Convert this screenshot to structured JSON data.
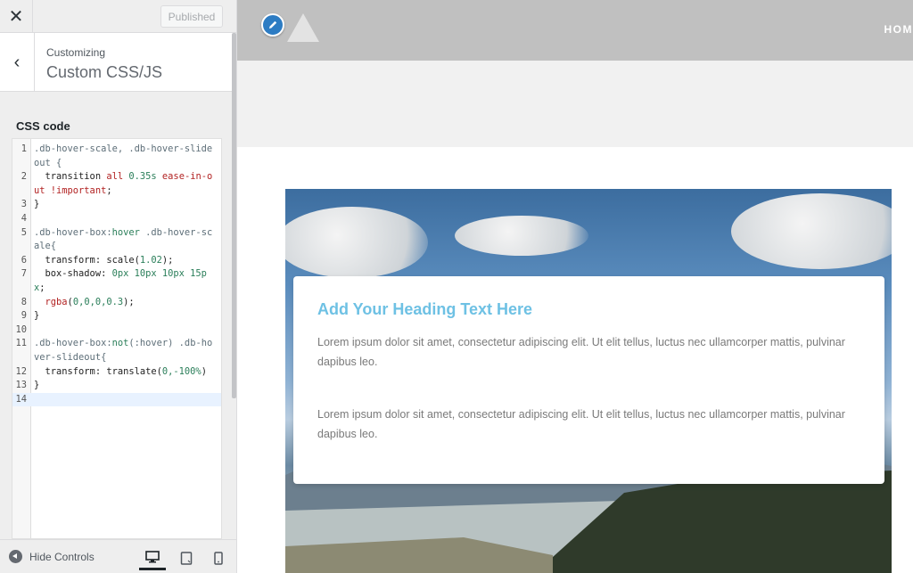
{
  "sidebar": {
    "close_glyph": "✕",
    "published_label": "Published",
    "back_glyph": "‹",
    "breadcrumb": "Customizing",
    "section_title": "Custom CSS/JS",
    "css_label": "CSS code",
    "footer": {
      "hide_controls_label": "Hide Controls",
      "devices": [
        "desktop-icon",
        "tablet-icon",
        "mobile-icon"
      ],
      "active_device": "desktop"
    }
  },
  "editor": {
    "lines": [
      {
        "n": "1",
        "segments": [
          {
            "t": ".db-hover-scale, .db-hover-slideout {",
            "c": "sel"
          }
        ]
      },
      {
        "n": "2",
        "segments": [
          {
            "t": "  transition ",
            "c": "prop"
          },
          {
            "t": "all",
            "c": "str"
          },
          {
            "t": " 0.35s ",
            "c": "num"
          },
          {
            "t": "ease-in-out",
            "c": "str"
          },
          {
            "t": " !important",
            "c": "str"
          },
          {
            "t": ";",
            "c": "prop"
          }
        ]
      },
      {
        "n": "3",
        "segments": [
          {
            "t": "}",
            "c": "prop"
          }
        ]
      },
      {
        "n": "4",
        "segments": [
          {
            "t": "",
            "c": "prop"
          }
        ]
      },
      {
        "n": "5",
        "segments": [
          {
            "t": ".db-hover-box:",
            "c": "sel"
          },
          {
            "t": "hover",
            "c": "num"
          },
          {
            "t": " .db-hover-scale{",
            "c": "sel"
          }
        ]
      },
      {
        "n": "6",
        "segments": [
          {
            "t": "  transform: scale(",
            "c": "prop"
          },
          {
            "t": "1.02",
            "c": "num"
          },
          {
            "t": ");",
            "c": "prop"
          }
        ]
      },
      {
        "n": "7",
        "segments": [
          {
            "t": "  box-shadow: ",
            "c": "prop"
          },
          {
            "t": "0px 10px 10px 15px",
            "c": "num"
          },
          {
            "t": ";",
            "c": "prop"
          }
        ]
      },
      {
        "n": "8",
        "segments": [
          {
            "t": "  rgba",
            "c": "str"
          },
          {
            "t": "(",
            "c": "prop"
          },
          {
            "t": "0,0,0,0.3",
            "c": "num"
          },
          {
            "t": ");",
            "c": "prop"
          }
        ]
      },
      {
        "n": "9",
        "segments": [
          {
            "t": "}",
            "c": "prop"
          }
        ]
      },
      {
        "n": "10",
        "segments": [
          {
            "t": "",
            "c": "prop"
          }
        ]
      },
      {
        "n": "11",
        "segments": [
          {
            "t": ".db-hover-box:",
            "c": "sel"
          },
          {
            "t": "not",
            "c": "num"
          },
          {
            "t": "(:hover) .db-hover-slideout{",
            "c": "sel"
          }
        ]
      },
      {
        "n": "12",
        "segments": [
          {
            "t": "  transform: translate(",
            "c": "prop"
          },
          {
            "t": "0,-100%",
            "c": "num"
          },
          {
            "t": ")",
            "c": "prop"
          }
        ]
      },
      {
        "n": "13",
        "segments": [
          {
            "t": "}",
            "c": "prop"
          }
        ]
      },
      {
        "n": "14",
        "segments": [
          {
            "t": "",
            "c": "prop"
          }
        ],
        "active": true
      }
    ]
  },
  "preview": {
    "edit_icon": "pencil-icon",
    "nav_home": "HOM",
    "card": {
      "heading": "Add Your Heading Text Here",
      "paragraph_1": "Lorem ipsum dolor sit amet, consectetur adipiscing elit. Ut elit tellus, luctus nec ullamcorper mattis, pulvinar dapibus leo.",
      "paragraph_2": "Lorem ipsum dolor sit amet, consectetur adipiscing elit. Ut elit tellus, luctus nec ullamcorper mattis, pulvinar dapibus leo."
    }
  },
  "colors": {
    "heading_accent": "#6ec1e4",
    "edit_button": "#2d7cc3",
    "header_bg": "#c0c0c0"
  }
}
